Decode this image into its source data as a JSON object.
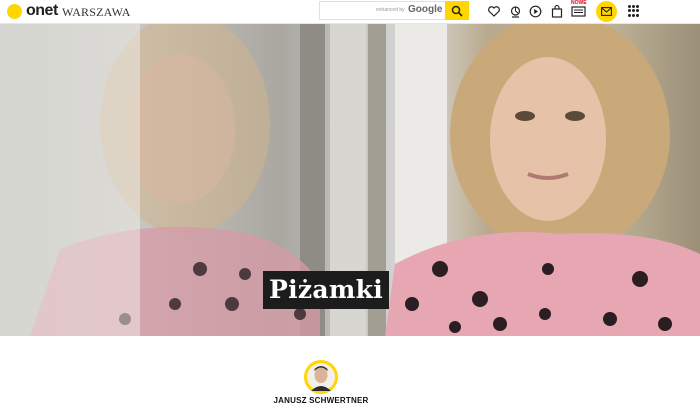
{
  "header": {
    "brand": "onet",
    "city": "WARSZAWA",
    "search": {
      "placeholder": "",
      "powered_by": "enhanced by",
      "provider": "Google"
    },
    "nowe_badge": "NOWE",
    "icons": [
      "heart-icon",
      "horoscope-icon",
      "play-icon",
      "shopping-bag-icon",
      "tv-program-icon",
      "mail-icon",
      "apps-grid-icon"
    ],
    "accent": "#ffd600"
  },
  "article": {
    "title": "Piżamki",
    "author": "JANUSZ SCHWERTNER"
  }
}
